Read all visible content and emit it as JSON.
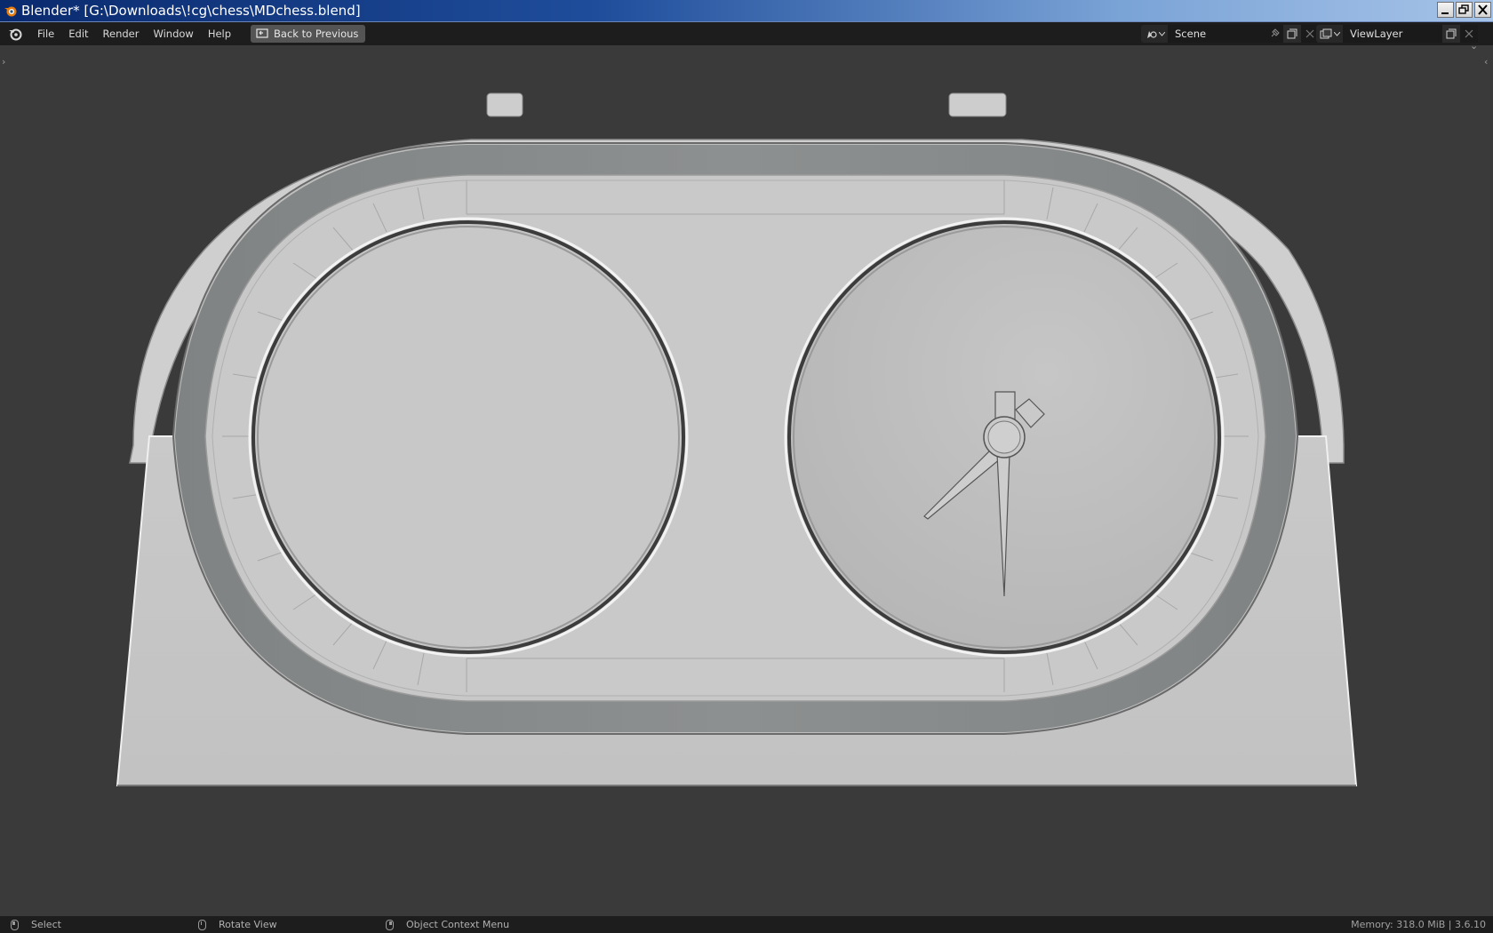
{
  "window": {
    "title": "Blender* [G:\\Downloads\\!cg\\chess\\MDchess.blend]"
  },
  "menu": {
    "items": [
      "File",
      "Edit",
      "Render",
      "Window",
      "Help"
    ],
    "back_button": "Back to Previous"
  },
  "scene_selector": {
    "value": "Scene"
  },
  "view_layer_selector": {
    "value": "ViewLayer"
  },
  "status_bar": {
    "left_click": "Select",
    "middle_click": "Rotate View",
    "right_click": "Object Context Menu",
    "stats": "Memory: 318.0 MiB | 3.6.10"
  },
  "colors": {
    "viewport_bg": "#3a3a3a",
    "header_bg": "#1d1d1d",
    "model_surface": "#c6c6c6",
    "accent": "#e87d0d"
  }
}
